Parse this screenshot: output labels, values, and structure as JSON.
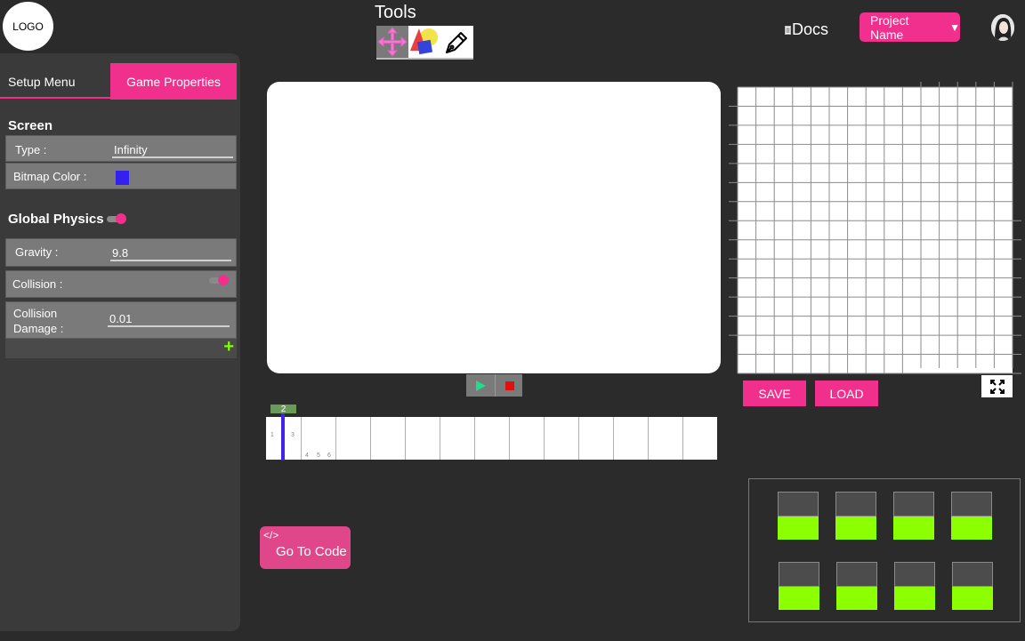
{
  "header": {
    "logo": "LOGO",
    "tools_label": "Tools",
    "tools": [
      {
        "name": "move-tool",
        "icon": "move-arrows-icon"
      },
      {
        "name": "shapes-tool",
        "icon": "shapes-icon"
      },
      {
        "name": "pen-tool",
        "icon": "pen-icon"
      }
    ],
    "docs_label": "Docs",
    "project_name": "Project Name",
    "project_caret": "▼"
  },
  "left_panel": {
    "tabs": [
      "Setup Menu",
      "Game Properties"
    ],
    "active_tab": "Game Properties",
    "screen": {
      "title": "Screen",
      "type_label": "Type :",
      "type_value": "Infinity",
      "bitmap_color_label": "Bitmap Color :",
      "bitmap_color": "#3322ee"
    },
    "physics": {
      "title": "Global Physics",
      "enabled": true,
      "gravity_label": "Gravity :",
      "gravity_value": "9.8",
      "collision_label": "Collision :",
      "collision_enabled": true,
      "collision_damage_label_1": "Collision",
      "collision_damage_label_2": "Damage :",
      "collision_damage_value": "0.01",
      "add_icon": "+"
    }
  },
  "playback": {
    "play_icon": "play-icon",
    "stop_icon": "stop-icon"
  },
  "timeline": {
    "current_frame": "2",
    "cell_numbers": [
      "1",
      "3",
      "4",
      "5",
      "6"
    ]
  },
  "grid_panel": {
    "save_label": "SAVE",
    "load_label": "LOAD",
    "expand_icon": "expand-icon"
  },
  "code": {
    "icon_text": "</>",
    "label": "Go To Code"
  },
  "colors": {
    "accent": "#f0308c",
    "background": "#2b2b2b",
    "panel": "#3a3a3a",
    "slot_fill": "#8cff00"
  }
}
